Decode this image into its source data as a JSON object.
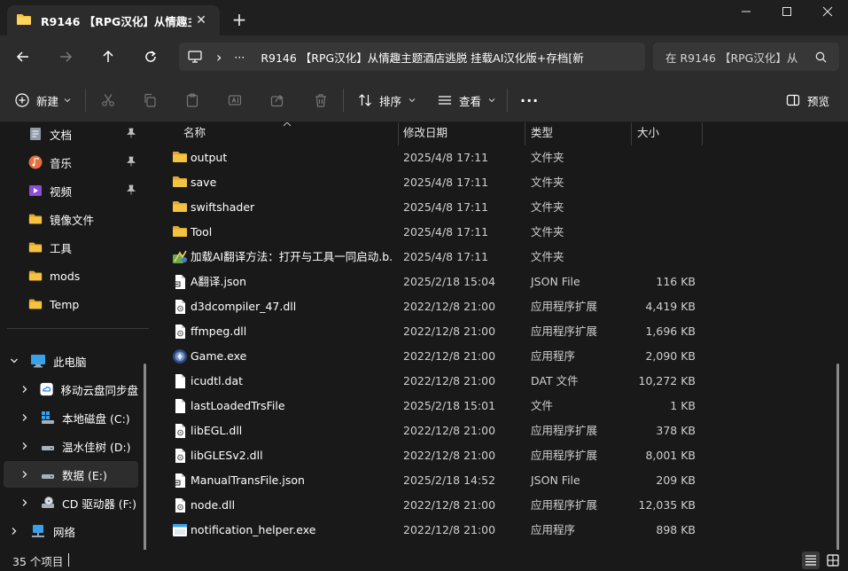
{
  "tab": {
    "title": "R9146 【RPG汉化】从情趣主题",
    "close": "✕",
    "new_tab": "+"
  },
  "window": {
    "minimize": "—",
    "maximize": "☐",
    "close": "✕"
  },
  "address": {
    "more": "···",
    "chevron": "›",
    "path": "R9146 【RPG汉化】从情趣主题酒店逃脱 挂载AI汉化版+存档[新"
  },
  "search": {
    "placeholder": "在 R9146 【RPG汉化】从"
  },
  "toolbar": {
    "new": "新建",
    "sort": "排序",
    "view": "查看",
    "more": "···",
    "preview": "预览"
  },
  "sidebar": {
    "quick": [
      {
        "label": "文档",
        "icon": "documents-icon",
        "pinned": true
      },
      {
        "label": "音乐",
        "icon": "music-icon",
        "pinned": true
      },
      {
        "label": "视频",
        "icon": "video-icon",
        "pinned": true
      },
      {
        "label": "镜像文件",
        "icon": "folder-icon",
        "pinned": false
      },
      {
        "label": "工具",
        "icon": "folder-icon",
        "pinned": false
      },
      {
        "label": "mods",
        "icon": "folder-icon",
        "pinned": false
      },
      {
        "label": "Temp",
        "icon": "folder-icon",
        "pinned": false
      }
    ],
    "this_pc": "此电脑",
    "drives": [
      {
        "label": "移动云盘同步盘",
        "icon": "cloud-drive-icon",
        "selected": false
      },
      {
        "label": "本地磁盘 (C:)",
        "icon": "windows-drive-icon",
        "selected": false
      },
      {
        "label": "温水佳树 (D:)",
        "icon": "drive-icon",
        "selected": false
      },
      {
        "label": "数据 (E:)",
        "icon": "drive-icon",
        "selected": true
      },
      {
        "label": "CD 驱动器 (F:)",
        "icon": "cd-drive-icon",
        "selected": false
      }
    ],
    "network": "网络"
  },
  "columns": {
    "name": "名称",
    "date": "修改日期",
    "type": "类型",
    "size": "大小"
  },
  "files": [
    {
      "name": "output",
      "date": "2025/4/8 17:11",
      "type": "文件夹",
      "size": "",
      "icon": "folder-icon"
    },
    {
      "name": "save",
      "date": "2025/4/8 17:11",
      "type": "文件夹",
      "size": "",
      "icon": "folder-icon"
    },
    {
      "name": "swiftshader",
      "date": "2025/4/8 17:11",
      "type": "文件夹",
      "size": "",
      "icon": "folder-icon"
    },
    {
      "name": "Tool",
      "date": "2025/4/8 17:11",
      "type": "文件夹",
      "size": "",
      "icon": "folder-icon"
    },
    {
      "name": "加载AI翻译方法：打开与工具一同启动.b...",
      "date": "2025/4/8 17:11",
      "type": "文件夹",
      "size": "",
      "icon": "image-folder-icon"
    },
    {
      "name": "A翻译.json",
      "date": "2025/2/18 15:04",
      "type": "JSON File",
      "size": "116 KB",
      "icon": "json-file-icon"
    },
    {
      "name": "d3dcompiler_47.dll",
      "date": "2022/12/8 21:00",
      "type": "应用程序扩展",
      "size": "4,419 KB",
      "icon": "dll-file-icon"
    },
    {
      "name": "ffmpeg.dll",
      "date": "2022/12/8 21:00",
      "type": "应用程序扩展",
      "size": "1,696 KB",
      "icon": "dll-file-icon"
    },
    {
      "name": "Game.exe",
      "date": "2022/12/8 21:00",
      "type": "应用程序",
      "size": "2,090 KB",
      "icon": "game-exe-icon"
    },
    {
      "name": "icudtl.dat",
      "date": "2022/12/8 21:00",
      "type": "DAT 文件",
      "size": "10,272 KB",
      "icon": "file-icon"
    },
    {
      "name": "lastLoadedTrsFile",
      "date": "2025/2/18 15:01",
      "type": "文件",
      "size": "1 KB",
      "icon": "file-icon"
    },
    {
      "name": "libEGL.dll",
      "date": "2022/12/8 21:00",
      "type": "应用程序扩展",
      "size": "378 KB",
      "icon": "dll-file-icon"
    },
    {
      "name": "libGLESv2.dll",
      "date": "2022/12/8 21:00",
      "type": "应用程序扩展",
      "size": "8,001 KB",
      "icon": "dll-file-icon"
    },
    {
      "name": "ManualTransFile.json",
      "date": "2025/2/18 14:52",
      "type": "JSON File",
      "size": "209 KB",
      "icon": "json-file-icon"
    },
    {
      "name": "node.dll",
      "date": "2022/12/8 21:00",
      "type": "应用程序扩展",
      "size": "12,035 KB",
      "icon": "dll-file-icon"
    },
    {
      "name": "notification_helper.exe",
      "date": "2022/12/8 21:00",
      "type": "应用程序",
      "size": "898 KB",
      "icon": "exe-icon"
    }
  ],
  "status": {
    "count": "35 个项目"
  },
  "colors": {
    "accent": "#4cc2ff",
    "folder": "#f5c342",
    "background": "#191919",
    "chrome": "#2c2c2c"
  }
}
